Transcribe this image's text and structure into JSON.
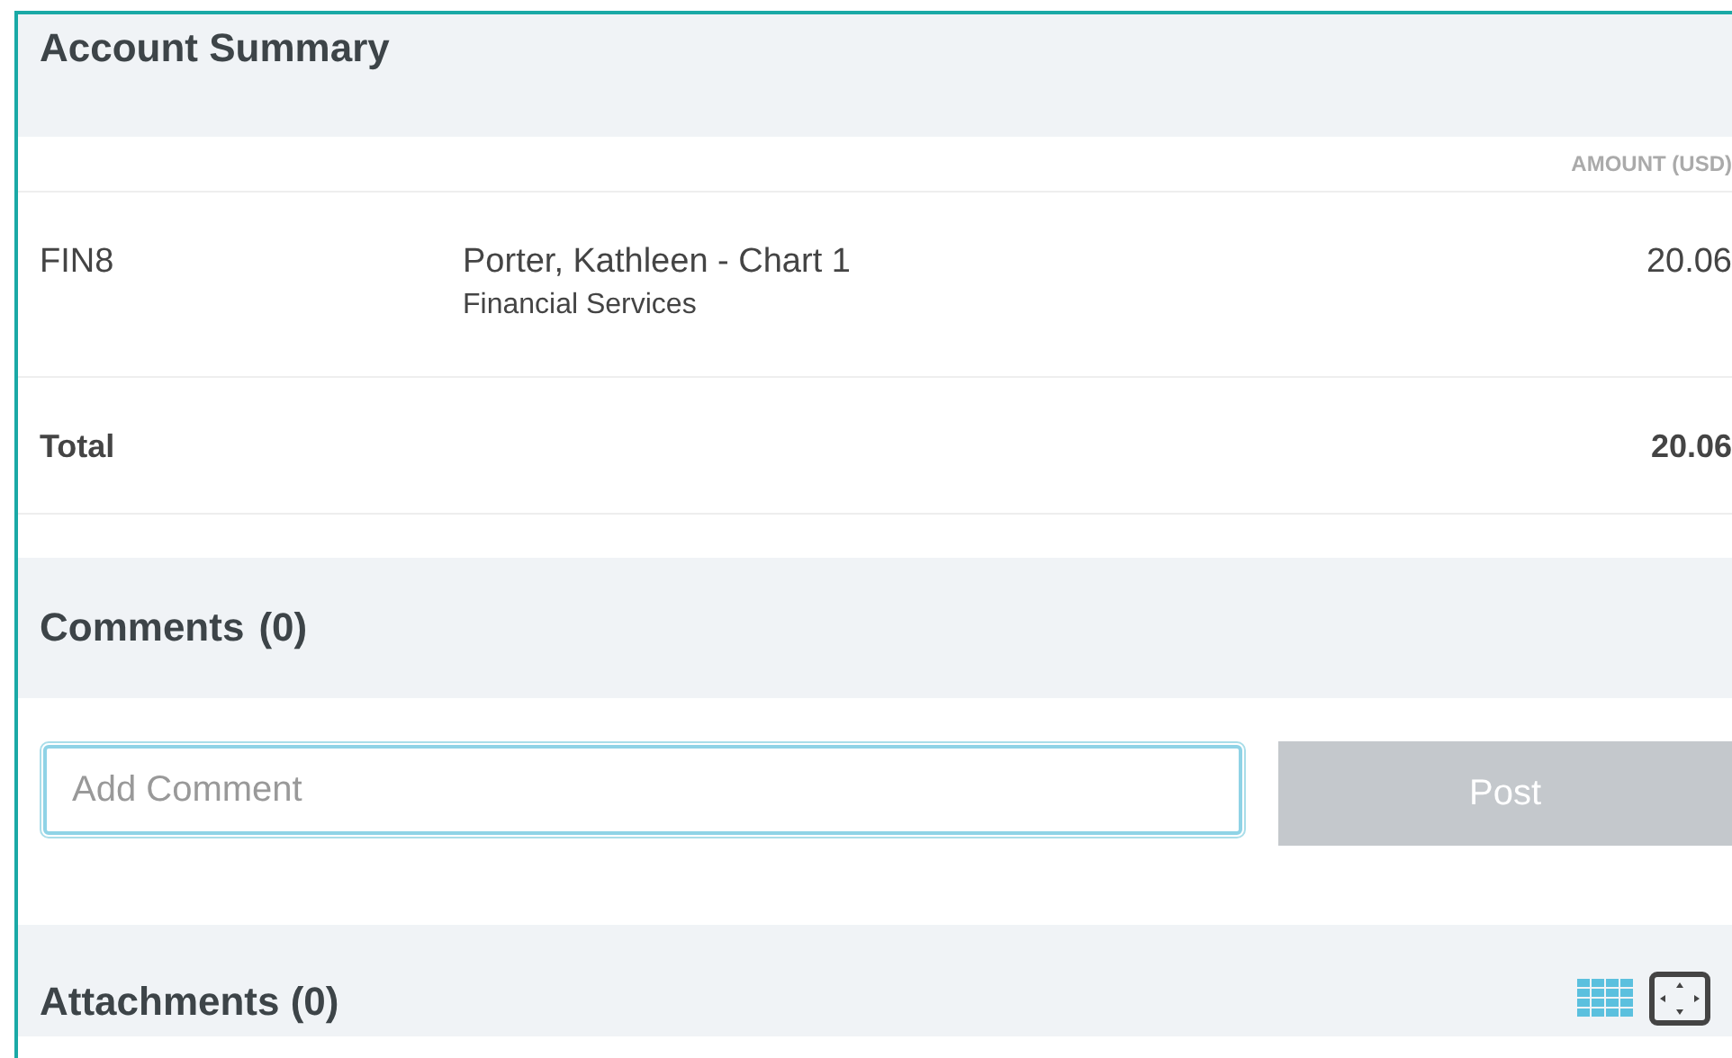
{
  "account_summary": {
    "title": "Account Summary",
    "amount_header": "AMOUNT (USD)",
    "rows": [
      {
        "code": "FIN8",
        "name": "Porter, Kathleen - Chart 1",
        "department": "Financial Services",
        "amount": "20.06"
      }
    ],
    "total": {
      "label": "Total",
      "amount": "20.06"
    }
  },
  "comments": {
    "title": "Comments",
    "count": "(0)",
    "placeholder": "Add Comment",
    "post_button": {
      "label": "Post",
      "disabled": true
    }
  },
  "attachments": {
    "title": "Attachments (0)"
  }
}
